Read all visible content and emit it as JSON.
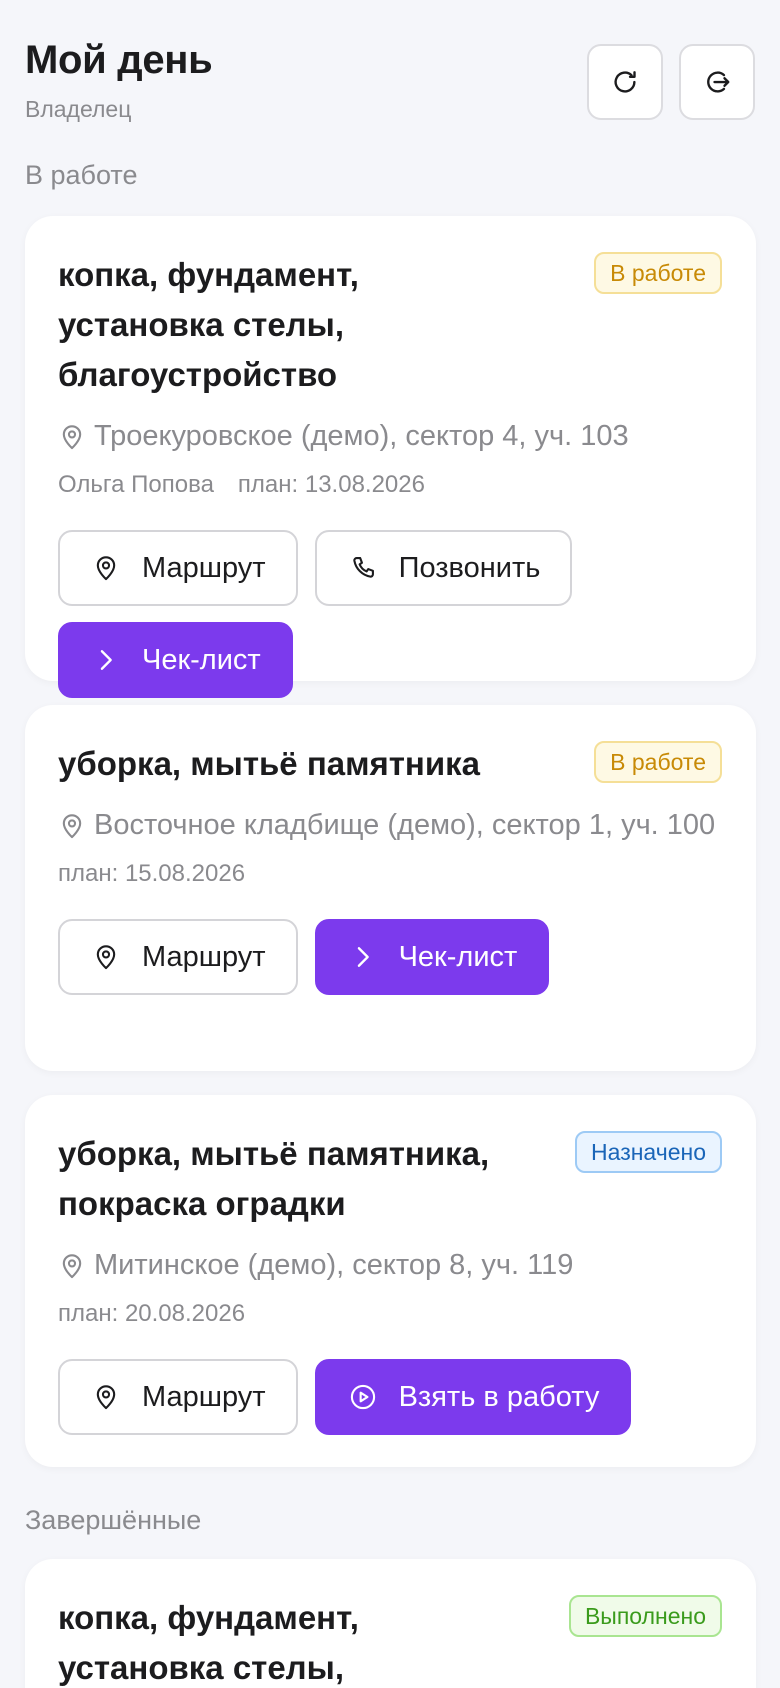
{
  "header": {
    "title": "Мой день",
    "subtitle": "Владелец"
  },
  "sections": {
    "in_progress": "В работе",
    "completed": "Завершённые"
  },
  "tasks": [
    {
      "title": "копка, фундамент, установка стелы, благоустройство",
      "status": "В работе",
      "location": "Троекуровское (демо), сектор 4, уч. 103",
      "assignee": "Ольга Попова",
      "plan": "план: 13.08.2026",
      "route": "Маршрут",
      "call": "Позвонить",
      "checklist": "Чек-лист"
    },
    {
      "title": "уборка, мытьё памятника",
      "status": "В работе",
      "location": "Восточное кладбище (демо), сектор 1, уч. 100",
      "plan": "план: 15.08.2026",
      "route": "Маршрут",
      "checklist": "Чек-лист"
    },
    {
      "title": "уборка, мытьё памятника, покраска оградки",
      "status": "Назначено",
      "location": "Митинское (демо), сектор 8, уч. 119",
      "plan": "план: 20.08.2026",
      "route": "Маршрут",
      "take": "Взять в работу"
    },
    {
      "title": "копка, фундамент, установка стелы, благоустройство",
      "status": "Выполнено"
    }
  ],
  "colors": {
    "accent": "#7c3aed",
    "background": "#f5f6fa"
  },
  "icons": {
    "refresh": "refresh-icon",
    "logout": "logout-icon",
    "pin": "map-pin-icon",
    "phone": "phone-icon",
    "chevron": "chevron-right-icon",
    "play": "play-circle-icon"
  }
}
